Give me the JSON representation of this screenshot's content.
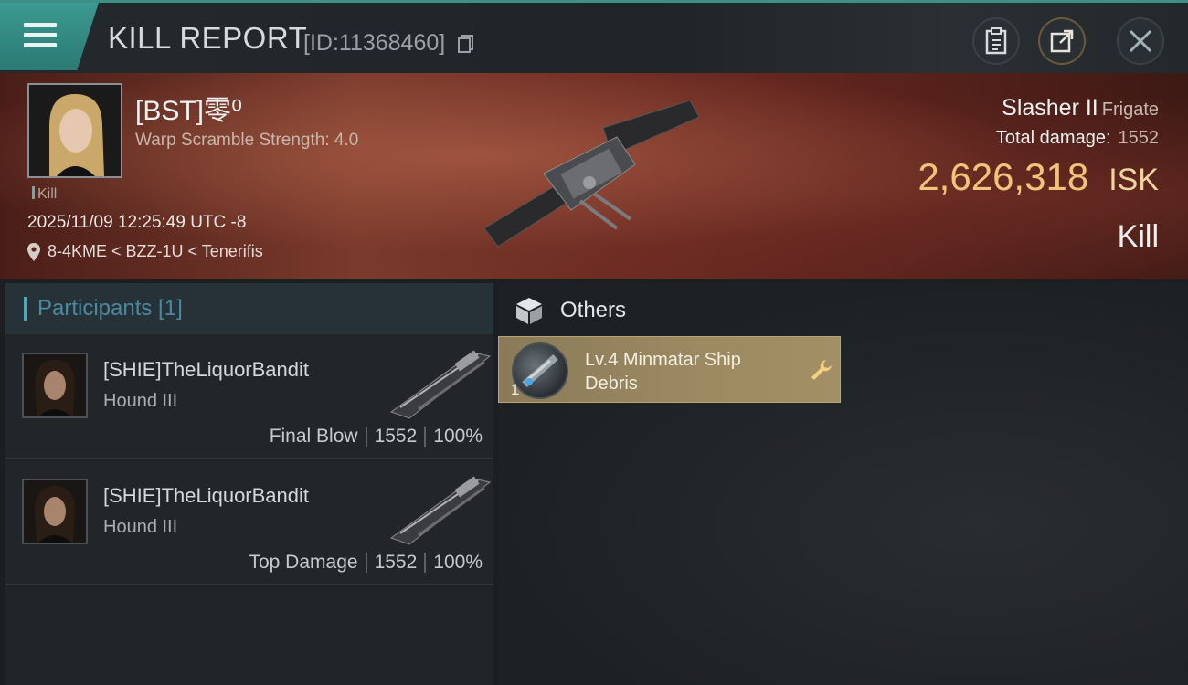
{
  "header": {
    "title": "KILL REPORT",
    "report_id": "[ID:11368460]",
    "icons": [
      "menu-icon",
      "copy-icon",
      "clipboard-icon",
      "share-icon",
      "close-icon"
    ]
  },
  "victim": {
    "pilot_name": "[BST]零⁰",
    "warp_scramble": "Warp Scramble Strength: 4.0",
    "tag": "Kill",
    "datetime": "2025/11/09 12:25:49 UTC -8",
    "location": "8-4KME < BZZ-1U < Tenerifis",
    "ship_name": "Slasher II",
    "ship_class": "Frigate",
    "total_damage_label": "Total damage:",
    "total_damage_value": "1552",
    "isk_value": "2,626,318",
    "isk_unit": "ISK",
    "kill_type": "Kill"
  },
  "participants": {
    "header": "Participants [1]",
    "rows": [
      {
        "name": "[SHIE]TheLiquorBandit",
        "ship": "Hound III",
        "role": "Final Blow",
        "damage": "1552",
        "percent": "100%"
      },
      {
        "name": "[SHIE]TheLiquorBandit",
        "ship": "Hound III",
        "role": "Top Damage",
        "damage": "1552",
        "percent": "100%"
      }
    ]
  },
  "others": {
    "header": "Others",
    "items": [
      {
        "name": "Lv.4 Minmatar Ship Debris",
        "quantity": "1"
      }
    ]
  },
  "colors": {
    "accent_teal": "#3f8f88",
    "isk_gold": "#f2c47a",
    "item_card": "#9c8a62"
  }
}
